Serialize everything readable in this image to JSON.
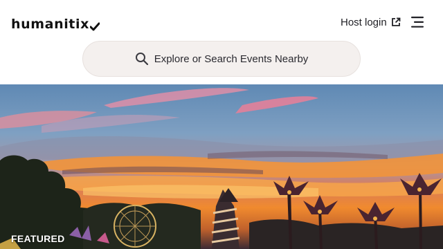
{
  "brand": {
    "logo_text": "HUMANITIX",
    "color": "#111111"
  },
  "header": {
    "host_login_label": "Host login",
    "host_login_icon": "external-link-icon",
    "menu_icon": "hamburger-menu-icon"
  },
  "search": {
    "placeholder": "Explore or Search Events Nearby",
    "icon": "search-icon",
    "background": "#f4f0ee"
  },
  "hero": {
    "image": "festival-sunset-photo",
    "label": "FEATURED"
  }
}
